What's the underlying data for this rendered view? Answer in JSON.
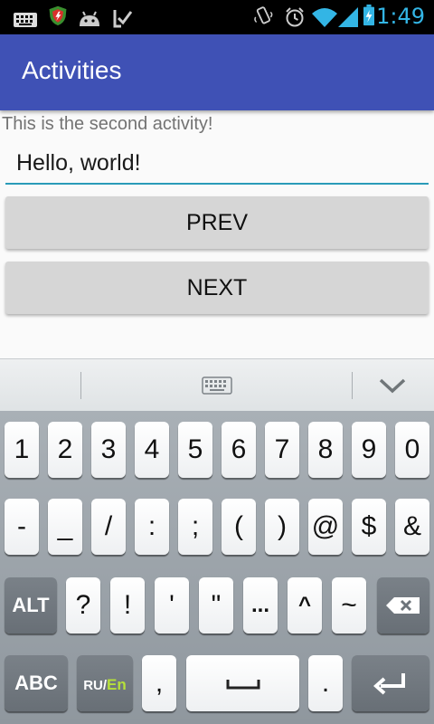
{
  "status_bar": {
    "time": "1:49",
    "left_icons": [
      "keyboard-icon",
      "shield-app-icon",
      "android-icon",
      "checkmark-icon"
    ],
    "right_icons": [
      "vibrate-icon",
      "alarm-icon",
      "wifi-icon",
      "signal-icon",
      "battery-charging-icon"
    ],
    "accent_color": "#33b5e5"
  },
  "app_bar": {
    "title": "Activities",
    "color": "#3f51b5"
  },
  "main": {
    "intro_text": "This is the second activity!",
    "text_field": {
      "value": "Hello, world!"
    },
    "prev_button": "PREV",
    "next_button": "NEXT"
  },
  "keyboard": {
    "row1": [
      "1",
      "2",
      "3",
      "4",
      "5",
      "6",
      "7",
      "8",
      "9",
      "0"
    ],
    "row2": [
      "-",
      "_",
      "/",
      ":",
      ";",
      "(",
      ")",
      "@",
      "$",
      "&"
    ],
    "row3": {
      "alt": "ALT",
      "keys": [
        "?",
        "!",
        "'",
        "\"",
        "...",
        "^",
        "~"
      ],
      "backspace": "backspace-icon"
    },
    "row4": {
      "abc": "ABC",
      "lang_ru": "RU/",
      "lang_en": "En",
      "comma": ",",
      "period": ".",
      "enter": "enter-icon",
      "space": "space-icon"
    }
  }
}
